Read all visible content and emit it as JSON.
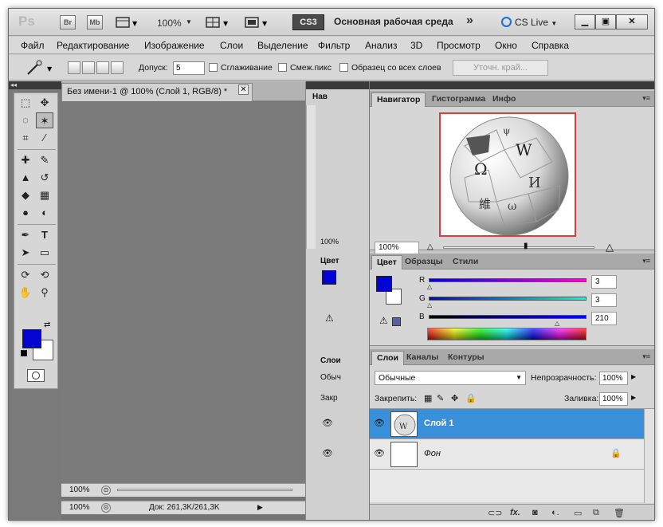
{
  "appbar": {
    "logo": "Ps",
    "bridge": "Br",
    "minibridge": "Mb",
    "zoom": "100%",
    "cs3": "CS3",
    "workspace": "Основная рабочая среда",
    "more": "»",
    "cslive": "CS Live"
  },
  "menu": [
    "Файл",
    "Редактирование",
    "Изображение",
    "Слои",
    "Выделение",
    "Фильтр",
    "Анализ",
    "3D",
    "Просмотр",
    "Окно",
    "Справка"
  ],
  "options": {
    "tolerance_label": "Допуск:",
    "tolerance_value": "5",
    "antialias": "Сглаживание",
    "contiguous": "Смеж.пикс",
    "sample_all": "Образец со всех слоев",
    "refine": "Уточн. край..."
  },
  "document": {
    "tab_title": "Без имени-1 @ 100% (Слой 1, RGB/8) *",
    "zoom_top": "100%",
    "zoom_bottom": "100%",
    "doc_size": "Док: 261,3K/261,3K"
  },
  "mid_panel": {
    "nav_label": "Нав",
    "nav_zoom": "100%",
    "color_label": "Цвет",
    "layers_label": "Слои",
    "blend_short": "Обыч",
    "lock_short": "Закр"
  },
  "navigator": {
    "tabs": [
      "Навигатор",
      "Гистограмма",
      "Инфо"
    ],
    "zoom": "100%",
    "globe_letters": [
      "W",
      "Ω",
      "И",
      "維",
      "ψ",
      "ω"
    ]
  },
  "color": {
    "tabs": [
      "Цвет",
      "Образцы",
      "Стили"
    ],
    "channels": [
      {
        "label": "R",
        "value": "3"
      },
      {
        "label": "G",
        "value": "3"
      },
      {
        "label": "B",
        "value": "210"
      }
    ],
    "foreground": "#0303d2",
    "background": "#ffffff"
  },
  "layers": {
    "tabs": [
      "Слои",
      "Каналы",
      "Контуры"
    ],
    "blend_mode": "Обычные",
    "opacity_label": "Непрозрачность:",
    "opacity_value": "100%",
    "lock_label": "Закрепить:",
    "fill_label": "Заливка:",
    "fill_value": "100%",
    "items": [
      {
        "name": "Слой 1",
        "selected": true
      },
      {
        "name": "Фон",
        "selected": false
      }
    ]
  }
}
